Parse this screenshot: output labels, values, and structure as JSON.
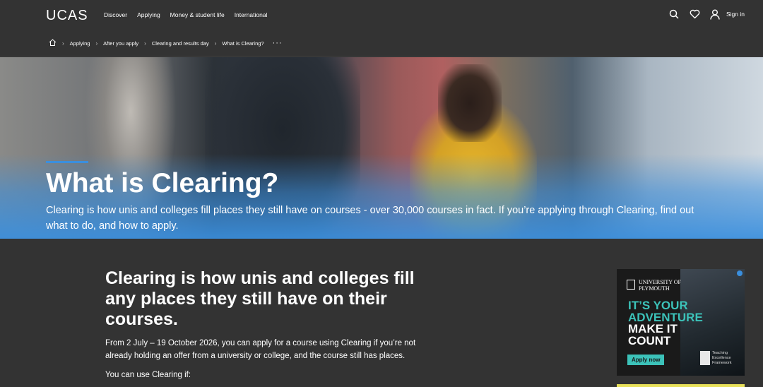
{
  "header": {
    "logo": "UCAS",
    "nav": [
      "Discover",
      "Applying",
      "Money & student life",
      "International"
    ],
    "icons": [
      "search-icon",
      "heart-icon",
      "user-icon"
    ],
    "sign_in": "Sign in"
  },
  "breadcrumb": {
    "items": [
      "Applying",
      "After you apply",
      "Clearing and results day",
      "What is Clearing?"
    ],
    "more": "···"
  },
  "hero": {
    "title": "What is Clearing?",
    "description": "Clearing is how unis and colleges fill places they still have on courses - over 30,000 courses in fact. If you’re applying through Clearing, find out what to do, and how to apply."
  },
  "main": {
    "heading": "Clearing is how unis and colleges fill any places they still have on their courses.",
    "paragraph": "From 2 July – 19 October 2026, you can apply for a course using Clearing if you’re not already holding an offer from a university or college, and the course still has places.",
    "paragraph2": "You can use Clearing if:"
  },
  "ad": {
    "university_line1": "UNIVERSITY OF",
    "university_line2": "PLYMOUTH",
    "headline": [
      "IT’S YOUR",
      "ADVENTURE",
      "MAKE IT",
      "COUNT"
    ],
    "apply_label": "Apply now",
    "tef_text_1": "Teaching",
    "tef_text_2": "Excellence",
    "tef_text_3": "Framework",
    "accent_color": "#3cc2b9"
  }
}
